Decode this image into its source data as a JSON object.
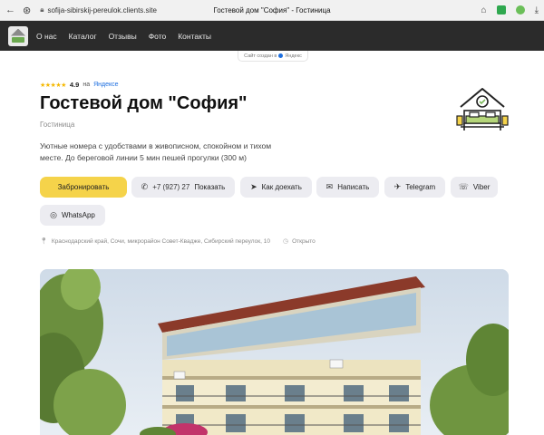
{
  "browser": {
    "url": "sofija-sibirskij-pereulok.clients.site",
    "page_title": "Гостевой дом \"София\" - Гостиница"
  },
  "site_nav": {
    "items": [
      "О нас",
      "Каталог",
      "Отзывы",
      "Фото",
      "Контакты"
    ]
  },
  "made_badge": "Сайт создан в",
  "made_brand": "Яндекс",
  "hero": {
    "stars": "★★★★★",
    "rating": "4.9",
    "rating_on": "на",
    "rating_source": "Яндексе",
    "title": "Гостевой дом \"София\"",
    "subtitle": "Гостиница",
    "description": "Уютные номера с удобствами в живописном, спокойном и тихом месте. До береговой линии 5 мин пешей прогулки (300 м)"
  },
  "buttons": {
    "book": "Забронировать",
    "phone": "+7 (927) 27",
    "show": "Показать",
    "route": "Как доехать",
    "write": "Написать",
    "telegram": "Telegram",
    "viber": "Viber",
    "whatsapp": "WhatsApp"
  },
  "address": {
    "text": "Краснодарский край, Сочи, микрорайон Совет-Квадже, Сибирский переулок, 10",
    "status": "Открыто"
  },
  "colors": {
    "accent": "#f5d34a",
    "nav_bg": "#2b2b2b",
    "rating_star": "#f5b800",
    "link": "#1d6fe0"
  }
}
